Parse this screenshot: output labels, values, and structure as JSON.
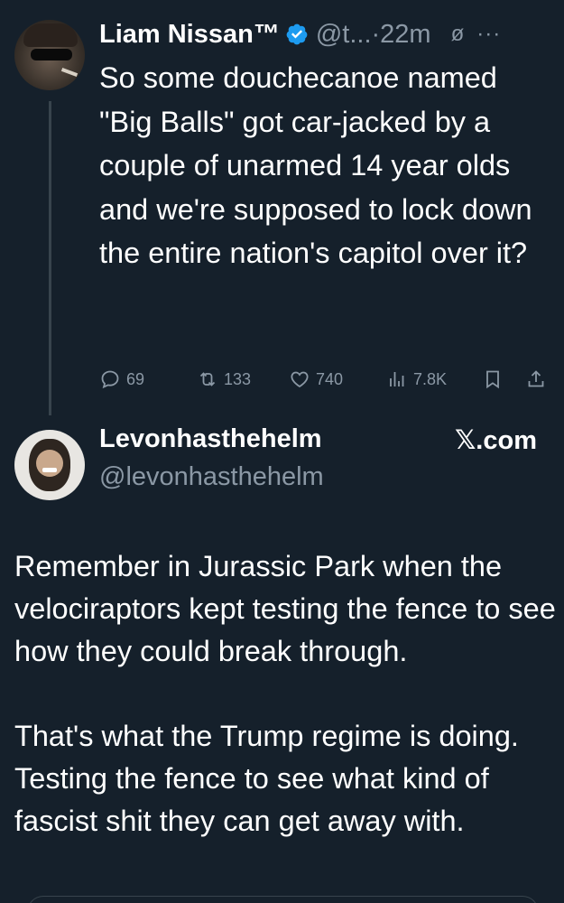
{
  "tweet_main": {
    "author_name": "Liam Nissan™",
    "handle": "@t...",
    "time": "·22m",
    "text": "So some douchecanoe named \"Big Balls\" got car-jacked by a couple of unarmed 14 year olds and we're supposed to lock down the entire nation's capitol over it?",
    "stats": {
      "replies": "69",
      "reposts": "133",
      "likes": "740",
      "views": "7.8K"
    },
    "icons": {
      "verified": "verified-badge-icon",
      "grok": "grok-icon",
      "more": "more-icon",
      "reply": "reply-icon",
      "repost": "repost-icon",
      "like": "heart-icon",
      "views": "views-icon",
      "bookmark": "bookmark-icon",
      "share": "share-icon"
    }
  },
  "tweet_quoted": {
    "author_name": "Levonhasthehelm",
    "handle": "@levonhasthehelm",
    "source": "𝕏.com",
    "paragraph1": "Remember in Jurassic Park when the velociraptors kept testing the fence to see how they could break through.",
    "paragraph2": "That's what the Trump regime is doing. Testing the fence to see what kind of fascist shit they can get away with."
  },
  "colors": {
    "background": "#15202b",
    "text": "#ffffff",
    "secondary_text": "#8b98a5",
    "verified_blue": "#1d9bf0",
    "divider": "#38444d"
  }
}
